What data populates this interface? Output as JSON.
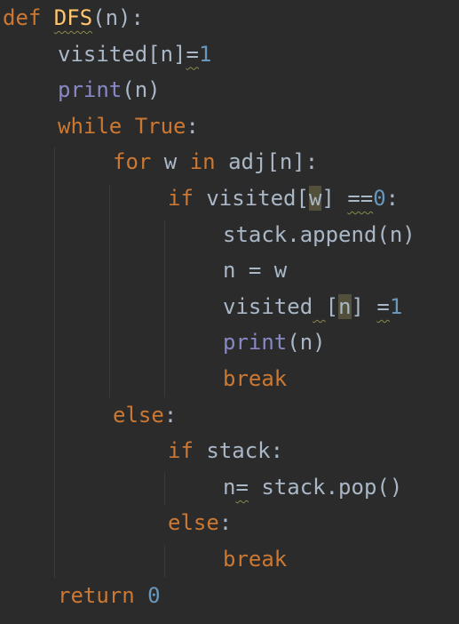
{
  "editor": {
    "language": "python",
    "lines": [
      {
        "indent": 0,
        "tokens": [
          {
            "text": "def ",
            "type": "kw"
          },
          {
            "text": "DFS",
            "type": "fn",
            "warn": true
          },
          {
            "text": "(n):",
            "type": "plain"
          }
        ]
      },
      {
        "indent": 1,
        "tokens": [
          {
            "text": "visited[n]",
            "type": "plain"
          },
          {
            "text": "=",
            "type": "plain",
            "warn": true
          },
          {
            "text": "1",
            "type": "num"
          }
        ]
      },
      {
        "indent": 1,
        "tokens": [
          {
            "text": "print",
            "type": "bi"
          },
          {
            "text": "(n)",
            "type": "plain"
          }
        ]
      },
      {
        "indent": 1,
        "tokens": [
          {
            "text": "while ",
            "type": "kw"
          },
          {
            "text": "True",
            "type": "kw"
          },
          {
            "text": ":",
            "type": "plain"
          }
        ]
      },
      {
        "indent": 2,
        "tokens": [
          {
            "text": "for ",
            "type": "kw"
          },
          {
            "text": "w ",
            "type": "plain"
          },
          {
            "text": "in ",
            "type": "kw"
          },
          {
            "text": "adj[n]:",
            "type": "plain"
          }
        ]
      },
      {
        "indent": 3,
        "tokens": [
          {
            "text": "if ",
            "type": "kw"
          },
          {
            "text": "visited[",
            "type": "plain"
          },
          {
            "text": "w",
            "type": "plain",
            "hl": true
          },
          {
            "text": "] ",
            "type": "plain"
          },
          {
            "text": "==",
            "type": "plain",
            "warn": true
          },
          {
            "text": "0",
            "type": "num"
          },
          {
            "text": ":",
            "type": "plain"
          }
        ]
      },
      {
        "indent": 4,
        "tokens": [
          {
            "text": "stack.append(n)",
            "type": "plain"
          }
        ]
      },
      {
        "indent": 4,
        "tokens": [
          {
            "text": "n = w",
            "type": "plain"
          }
        ]
      },
      {
        "indent": 4,
        "tokens": [
          {
            "text": "visited",
            "type": "plain"
          },
          {
            "text": " ",
            "type": "plain",
            "warn": true
          },
          {
            "text": "[",
            "type": "plain"
          },
          {
            "text": "n",
            "type": "plain",
            "hl": true
          },
          {
            "text": "] ",
            "type": "plain"
          },
          {
            "text": "=",
            "type": "plain",
            "warn": true
          },
          {
            "text": "1",
            "type": "num"
          }
        ]
      },
      {
        "indent": 4,
        "tokens": [
          {
            "text": "print",
            "type": "bi"
          },
          {
            "text": "(n)",
            "type": "plain"
          }
        ]
      },
      {
        "indent": 4,
        "tokens": [
          {
            "text": "break",
            "type": "kw"
          }
        ]
      },
      {
        "indent": 2,
        "tokens": [
          {
            "text": "else",
            "type": "kw"
          },
          {
            "text": ":",
            "type": "plain"
          }
        ]
      },
      {
        "indent": 3,
        "tokens": [
          {
            "text": "if ",
            "type": "kw"
          },
          {
            "text": "stack:",
            "type": "plain"
          }
        ]
      },
      {
        "indent": 4,
        "tokens": [
          {
            "text": "n",
            "type": "plain"
          },
          {
            "text": "=",
            "type": "plain",
            "warn": true
          },
          {
            "text": " stack.pop()",
            "type": "plain"
          }
        ]
      },
      {
        "indent": 3,
        "tokens": [
          {
            "text": "else",
            "type": "kw"
          },
          {
            "text": ":",
            "type": "plain"
          }
        ]
      },
      {
        "indent": 4,
        "tokens": [
          {
            "text": "break",
            "type": "kw"
          }
        ]
      },
      {
        "indent": 1,
        "tokens": [
          {
            "text": "return ",
            "type": "kw"
          },
          {
            "text": "0",
            "type": "num"
          }
        ]
      }
    ]
  },
  "colors": {
    "background": "#2B2B2B",
    "keyword": "#CC7832",
    "function_name": "#FFC66D",
    "builtin": "#8888C6",
    "number": "#6897BB",
    "text": "#A9B7C6",
    "highlight": "#52503A",
    "indent_guide": "#3A3A3A"
  }
}
